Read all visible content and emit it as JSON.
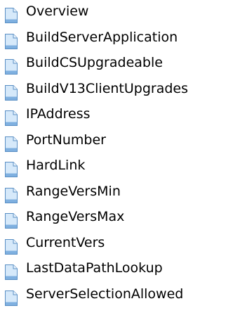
{
  "topics": [
    {
      "label": "Overview",
      "icon": "document-page-icon"
    },
    {
      "label": "BuildServerApplication",
      "icon": "document-page-icon"
    },
    {
      "label": "BuildCSUpgradeable",
      "icon": "document-page-icon"
    },
    {
      "label": "BuildV13ClientUpgrades",
      "icon": "document-page-icon"
    },
    {
      "label": "IPAddress",
      "icon": "document-page-icon"
    },
    {
      "label": "PortNumber",
      "icon": "document-page-icon"
    },
    {
      "label": "HardLink",
      "icon": "document-page-icon"
    },
    {
      "label": "RangeVersMin",
      "icon": "document-page-icon"
    },
    {
      "label": "RangeVersMax",
      "icon": "document-page-icon"
    },
    {
      "label": "CurrentVers",
      "icon": "document-page-icon"
    },
    {
      "label": "LastDataPathLookup",
      "icon": "document-page-icon"
    },
    {
      "label": "ServerSelectionAllowed",
      "icon": "document-page-icon"
    }
  ],
  "colors": {
    "icon_fill": "#d6e9fa",
    "icon_stroke": "#5a8fc4",
    "icon_fold": "#eaf4fd",
    "icon_band": "#7fb0e0"
  }
}
